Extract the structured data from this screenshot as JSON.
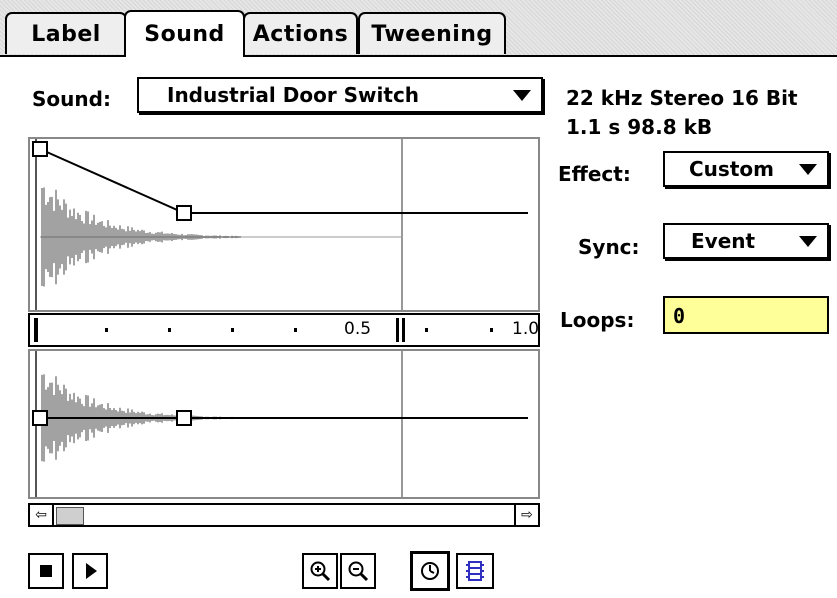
{
  "tabs": [
    {
      "label": "Label",
      "active": false
    },
    {
      "label": "Sound",
      "active": true
    },
    {
      "label": "Actions",
      "active": false
    },
    {
      "label": "Tweening",
      "active": false
    }
  ],
  "sound": {
    "label": "Sound:",
    "selected": "Industrial Door Switch",
    "info_line1": "22 kHz Stereo 16 Bit",
    "info_line2": "1.1 s 98.8 kB"
  },
  "effect": {
    "label": "Effect:",
    "value": "Custom"
  },
  "sync": {
    "label": "Sync:",
    "value": "Event"
  },
  "loops": {
    "label": "Loops:",
    "value": "0"
  },
  "timeline": {
    "mark_half": "0.5",
    "mark_one": "1.0"
  },
  "icons": {
    "stop": "stop-icon",
    "play": "play-icon",
    "zoom_in": "zoom-in-icon",
    "zoom_out": "zoom-out-icon",
    "time_units": "clock-icon",
    "frame_units": "filmstrip-icon",
    "scroll_left": "arrow-left-icon",
    "scroll_right": "arrow-right-icon"
  }
}
